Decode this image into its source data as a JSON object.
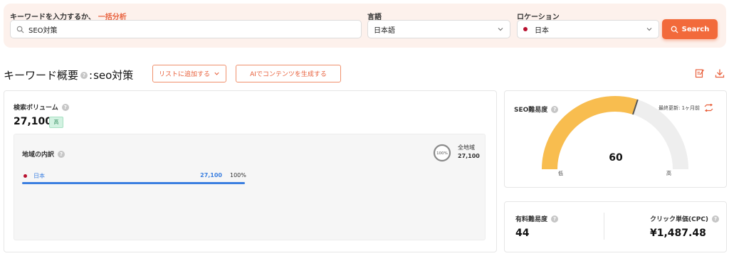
{
  "search": {
    "keyword_label": "キーワードを入力するか、",
    "bulk_link": "一括分析",
    "keyword_value": "SEO対策",
    "language_label": "言語",
    "language_value": "日本語",
    "location_label": "ロケーション",
    "location_value": "日本",
    "search_button": "Search"
  },
  "header": {
    "title": "キーワード概要",
    "title_keyword": "seo対策",
    "add_to_list": "リストに追加する",
    "ai_generate": "AIでコンテンツを生成する"
  },
  "volume": {
    "label": "検索ボリューム",
    "value": "27,100",
    "level": "高",
    "region_title": "地域の内訳",
    "donut_pct": "100%",
    "all_regions_label": "全地域",
    "all_regions_value": "27,100",
    "rows": [
      {
        "country": "日本",
        "volume": "27,100",
        "percent": "100%",
        "share": 1.0
      }
    ]
  },
  "seo": {
    "label": "SEO難易度",
    "last_updated": "最終更新: 1ヶ月前",
    "score": "60",
    "score_value": 60,
    "low": "低",
    "high": "高",
    "gauge_color": "#f8bd4f",
    "track_color": "#eeeeee"
  },
  "paid": {
    "label": "有料難易度",
    "value": "44",
    "cpc_label": "クリック単価(CPC)",
    "cpc_value": "¥1,487.48"
  },
  "colors": {
    "accent": "#f26a3b",
    "progress": "#3b7fe0"
  }
}
